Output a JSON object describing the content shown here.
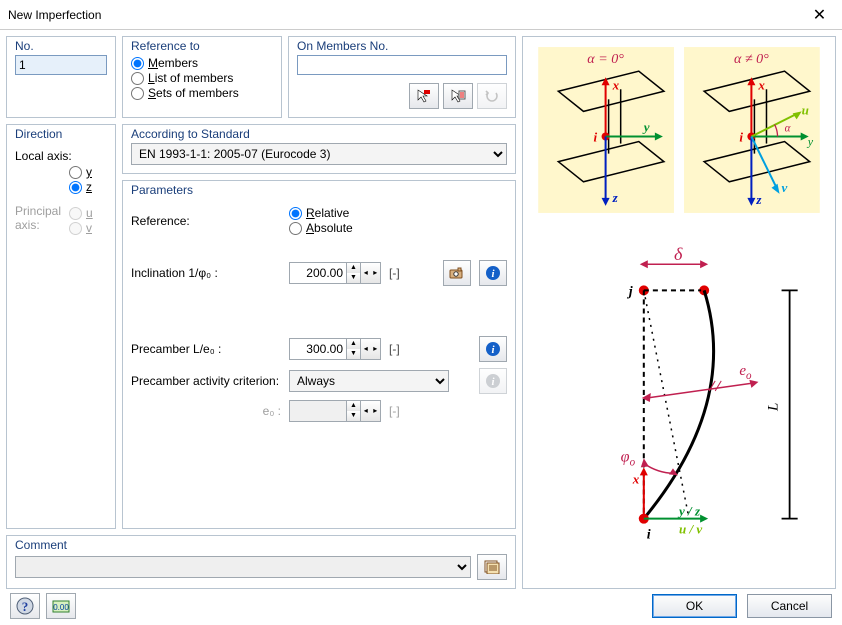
{
  "title": "New Imperfection",
  "close_icon": "✕",
  "no": {
    "title": "No.",
    "value": "1"
  },
  "reference_to": {
    "title": "Reference to",
    "members": "Members",
    "list": "List of members",
    "sets": "Sets of members",
    "selected": "members"
  },
  "on_members": {
    "title": "On Members No.",
    "value": ""
  },
  "direction": {
    "title": "Direction",
    "local_label": "Local axis:",
    "principal_label": "Principal axis:",
    "y": "y",
    "z": "z",
    "u": "u",
    "v": "v",
    "selected": "z"
  },
  "standard": {
    "title": "According to Standard",
    "value": "EN 1993-1-1: 2005-07  (Eurocode 3)"
  },
  "parameters": {
    "title": "Parameters",
    "reference_label": "Reference:",
    "relative": "Relative",
    "absolute": "Absolute",
    "reference_selected": "relative",
    "inclination_label": "Inclination 1/φ₀ :",
    "inclination_value": "200.00",
    "precamber_label": "Precamber L/e₀ :",
    "precamber_value": "300.00",
    "activity_label": "Precamber activity criterion:",
    "activity_value": "Always",
    "e0_label": "e₀ :",
    "e0_value": "",
    "unit_dash": "[-]"
  },
  "comment": {
    "title": "Comment",
    "value": ""
  },
  "footer": {
    "ok": "OK",
    "cancel": "Cancel"
  },
  "diagram": {
    "alpha0": "α = 0°",
    "alphan0": "α ≠ 0°",
    "x": "x",
    "y": "y",
    "z": "z",
    "u": "u",
    "v": "v",
    "i": "i",
    "j": "j",
    "alpha": "α",
    "delta": "δ",
    "e0": "e",
    "L": "L",
    "phi0": "φ",
    "yz": "y / z",
    "uv": "u / v",
    "o_sub": "o"
  }
}
